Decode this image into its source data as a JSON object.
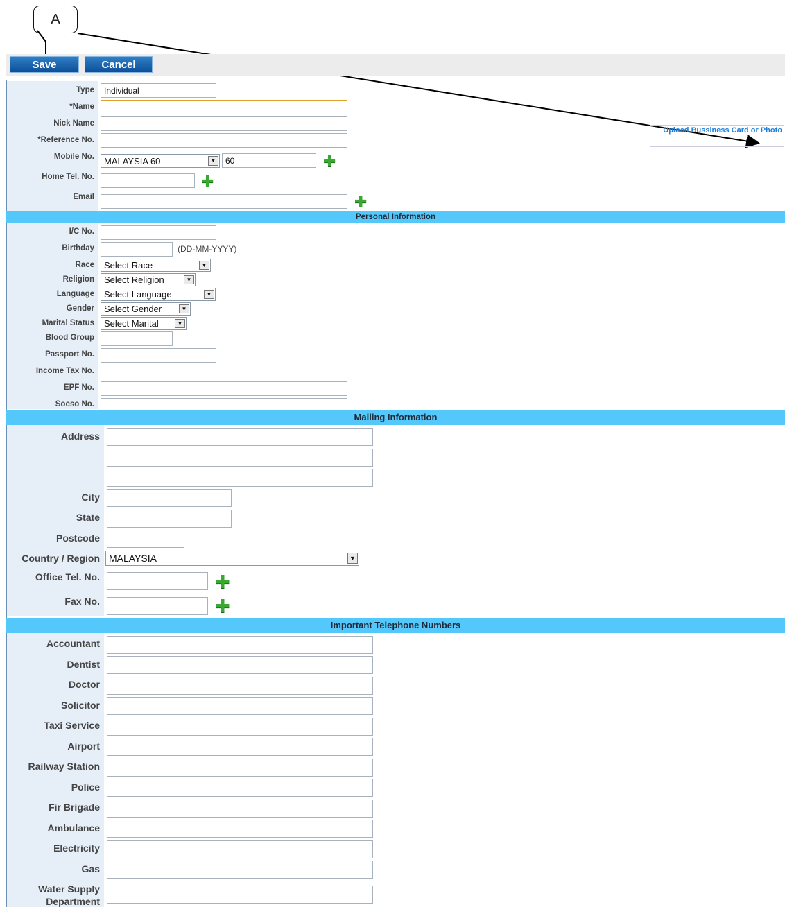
{
  "callout": {
    "label": "A"
  },
  "toolbar": {
    "save_label": "Save",
    "cancel_label": "Cancel"
  },
  "upload": {
    "label": "Upload Bussiness Card or Photo"
  },
  "basic": {
    "type_label": "Type",
    "type_value": "Individual",
    "name_label": "*Name",
    "nick_label": "Nick Name",
    "ref_label": "*Reference No.",
    "mobile_label": "Mobile No.",
    "mobile_country": "MALAYSIA 60",
    "mobile_code": "60",
    "home_label": "Home Tel. No.",
    "email_label": "Email"
  },
  "sections": {
    "personal": "Personal Information",
    "mailing": "Mailing Information",
    "important": "Important Telephone Numbers"
  },
  "personal": {
    "ic_label": "I/C No.",
    "birthday_label": "Birthday",
    "birthday_hint": "(DD-MM-YYYY)",
    "race_label": "Race",
    "race_value": "Select Race",
    "religion_label": "Religion",
    "religion_value": "Select Religion",
    "language_label": "Language",
    "language_value": "Select Language",
    "gender_label": "Gender",
    "gender_value": "Select Gender",
    "marital_label": "Marital Status",
    "marital_value": "Select Marital",
    "blood_label": "Blood Group",
    "passport_label": "Passport No.",
    "tax_label": "Income Tax No.",
    "epf_label": "EPF No.",
    "socso_label": "Socso No."
  },
  "mailing": {
    "address_label": "Address",
    "city_label": "City",
    "state_label": "State",
    "postcode_label": "Postcode",
    "country_label": "Country / Region",
    "country_value": "MALAYSIA",
    "office_label": "Office Tel. No.",
    "fax_label": "Fax No."
  },
  "important": {
    "accountant": "Accountant",
    "dentist": "Dentist",
    "doctor": "Doctor",
    "solicitor": "Solicitor",
    "taxi": "Taxi Service",
    "airport": "Airport",
    "railway": "Railway Station",
    "police": "Police",
    "fire": "Fir Brigade",
    "ambulance": "Ambulance",
    "electricity": "Electricity",
    "gas": "Gas",
    "water_line1": "Water Supply",
    "water_line2": "Department"
  },
  "icons": {
    "plus": "add-plus-icon",
    "dropdown": "dropdown-arrow-icon"
  },
  "colors": {
    "section_bar": "#55c8fb",
    "button": "#0d4f98",
    "label_column": "#e6eef7",
    "plus": "#3aa832"
  }
}
